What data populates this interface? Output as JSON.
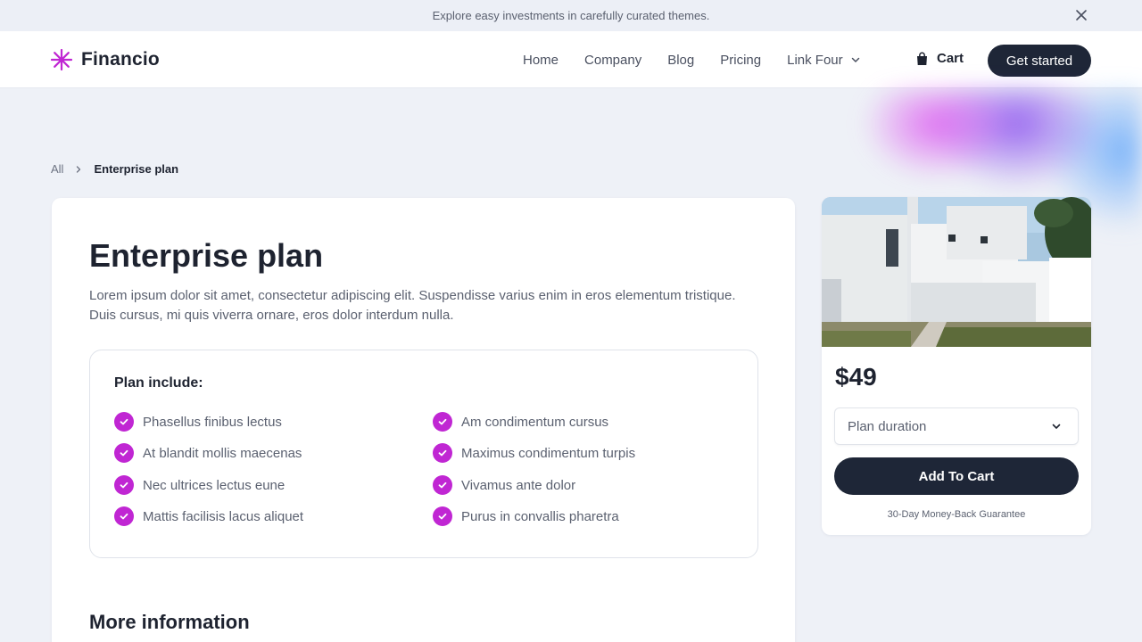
{
  "announcement": {
    "text": "Explore easy investments in carefully curated themes."
  },
  "header": {
    "logo_text": "Financio",
    "nav": [
      "Home",
      "Company",
      "Blog",
      "Pricing",
      "Link Four"
    ],
    "cart_label": "Cart",
    "cta_label": "Get started"
  },
  "breadcrumb": {
    "root": "All",
    "current": "Enterprise plan"
  },
  "main": {
    "title": "Enterprise plan",
    "description": "Lorem ipsum dolor sit amet, consectetur adipiscing elit. Suspendisse varius enim in eros elementum tristique. Duis cursus, mi quis viverra ornare, eros dolor interdum nulla.",
    "plan_heading": "Plan include:",
    "features_left": [
      "Phasellus finibus lectus",
      "At blandit mollis maecenas",
      "Nec ultrices lectus eune",
      "Mattis facilisis lacus aliquet"
    ],
    "features_right": [
      "Am condimentum cursus",
      "Maximus condimentum turpis",
      "Vivamus ante dolor",
      "Purus in convallis pharetra"
    ],
    "more_heading": "More information"
  },
  "sidebar": {
    "price": "$49",
    "duration_placeholder": "Plan duration",
    "add_button": "Add To Cart",
    "guarantee": "30-Day Money-Back Guarantee"
  },
  "colors": {
    "accent": "#c026d3",
    "dark_button": "#1e2637",
    "background": "#eef1f7"
  },
  "icons": [
    "close-icon",
    "star-logo-icon",
    "chevron-down-icon",
    "shopping-bag-icon",
    "chevron-right-icon",
    "check-circle-icon"
  ]
}
